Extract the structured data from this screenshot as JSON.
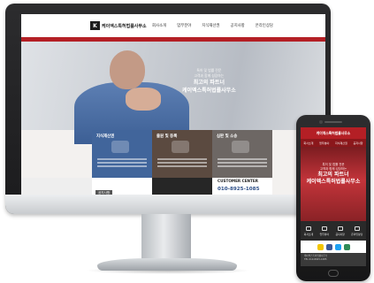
{
  "desktop": {
    "logo_mark": "K",
    "logo_text": "케이엑스특허법률사무소",
    "nav": [
      "회사소개",
      "업무분야",
      "지식재산권",
      "공지사항",
      "온라인상담"
    ],
    "hero_lines": [
      "특허 및 법률 전문",
      "고객과 함께 성장하는",
      "최고의 파트너",
      "케이엑스특허법률사무소"
    ],
    "boxes": [
      {
        "title": "지식재산권"
      },
      {
        "title": "출원 및 등록"
      },
      {
        "title": "심판 및 소송"
      }
    ],
    "bottom_tab": "공지사항",
    "customer_center_label": "CUSTOMER CENTER",
    "phone_number": "010-8925-1085"
  },
  "mobile": {
    "header_title": "케이엑스특허법률사무소",
    "nav": [
      "회사소개",
      "업무분야",
      "지식재산권",
      "공지사항"
    ],
    "hero_small": [
      "특허 및 법률 전문",
      "고객과 함께 성장하는"
    ],
    "hero_big": [
      "최고의 파트너",
      "케이엑스특허법률사무소"
    ],
    "menu": [
      "회사소개",
      "업무분야",
      "공지사항",
      "온라인상담"
    ],
    "social_colors": [
      "#f2c500",
      "#3b5998",
      "#1da1f2",
      "#2e8b57"
    ],
    "footer_lines": [
      "케이엑스특허법률사무소",
      "TEL 010-8925-1085"
    ]
  }
}
